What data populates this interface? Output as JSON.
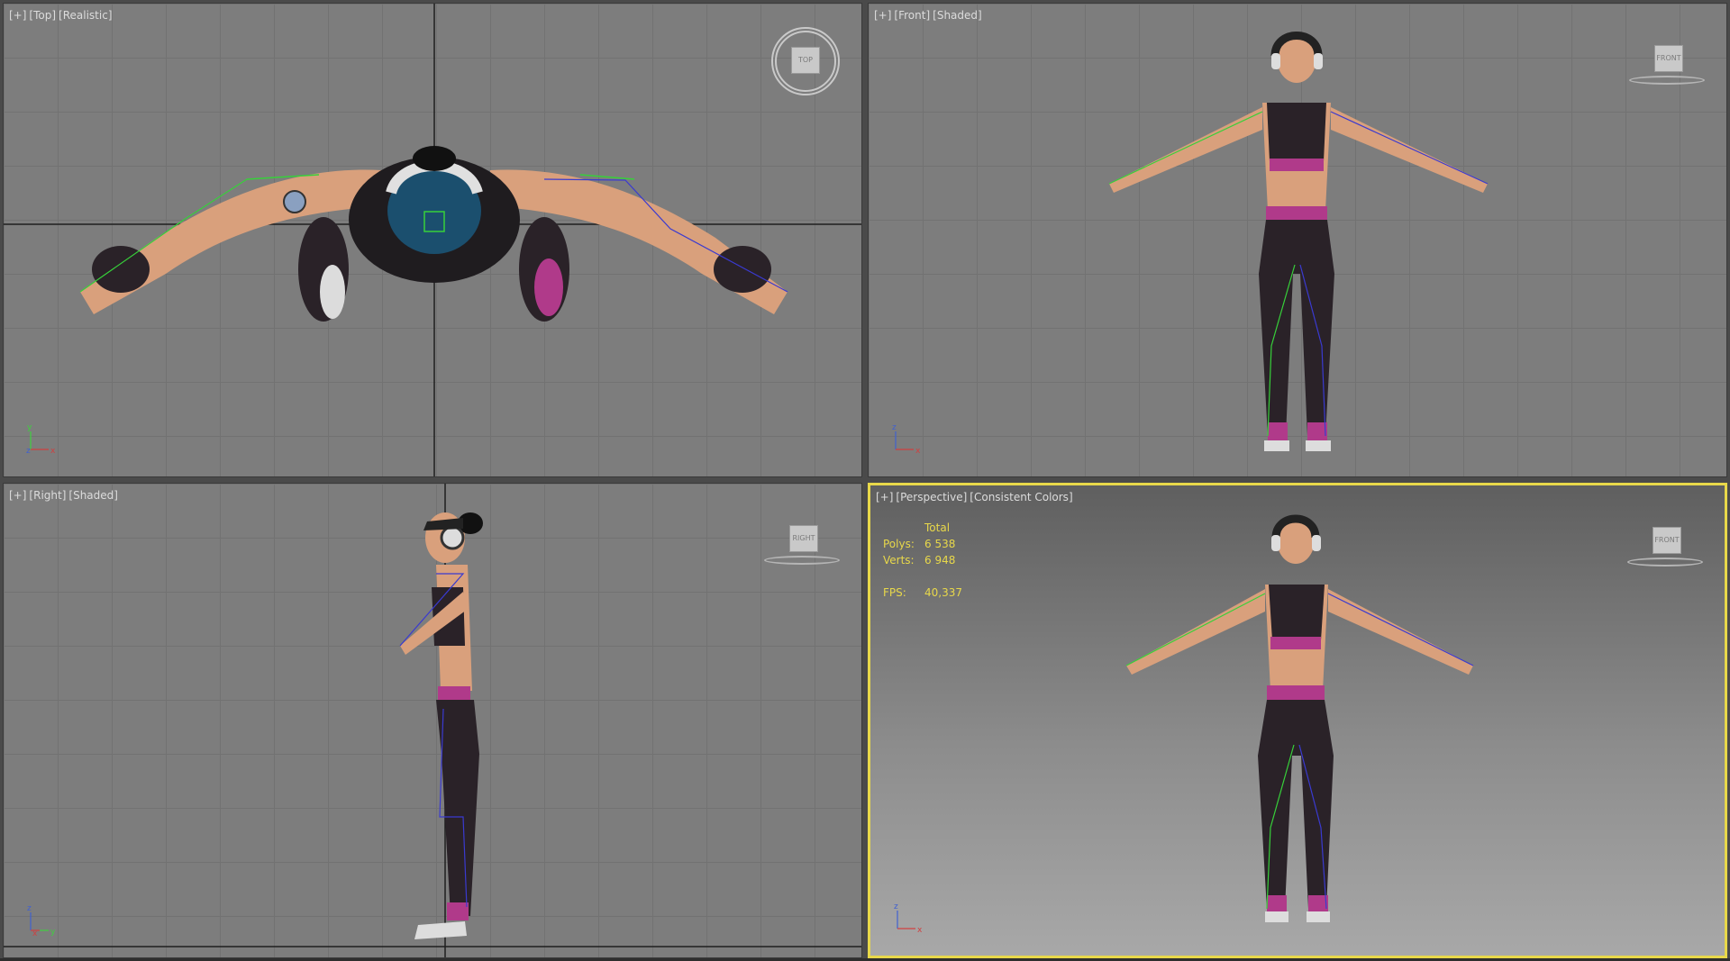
{
  "viewports": {
    "top": {
      "plus": "[+]",
      "view": "[Top]",
      "mode": "[Realistic]",
      "cube": "TOP"
    },
    "front": {
      "plus": "[+]",
      "view": "[Front]",
      "mode": "[Shaded]",
      "cube": "FRONT"
    },
    "right": {
      "plus": "[+]",
      "view": "[Right]",
      "mode": "[Shaded]",
      "cube": "RIGHT"
    },
    "persp": {
      "plus": "[+]",
      "view": "[Perspective]",
      "mode": "[Consistent Colors]",
      "cube": "FRONT"
    }
  },
  "axes": {
    "top": [
      "y",
      "z",
      "x"
    ],
    "front": [
      "z",
      "x"
    ],
    "right": [
      "z",
      "x",
      "y"
    ],
    "persp": [
      "z",
      "x"
    ]
  },
  "stats": {
    "header": "Total",
    "polys_label": "Polys:",
    "polys_value": "6 538",
    "verts_label": "Verts:",
    "verts_value": "6 948",
    "fps_label": "FPS:",
    "fps_value": "40,337"
  },
  "colors": {
    "active_border": "#e8d84a",
    "skin": "#d9a07c",
    "top_cloth": "#2a2228",
    "accent_magenta": "#b03a8a",
    "bone_green": "#37d03a",
    "bone_blue": "#3a3ad0"
  }
}
